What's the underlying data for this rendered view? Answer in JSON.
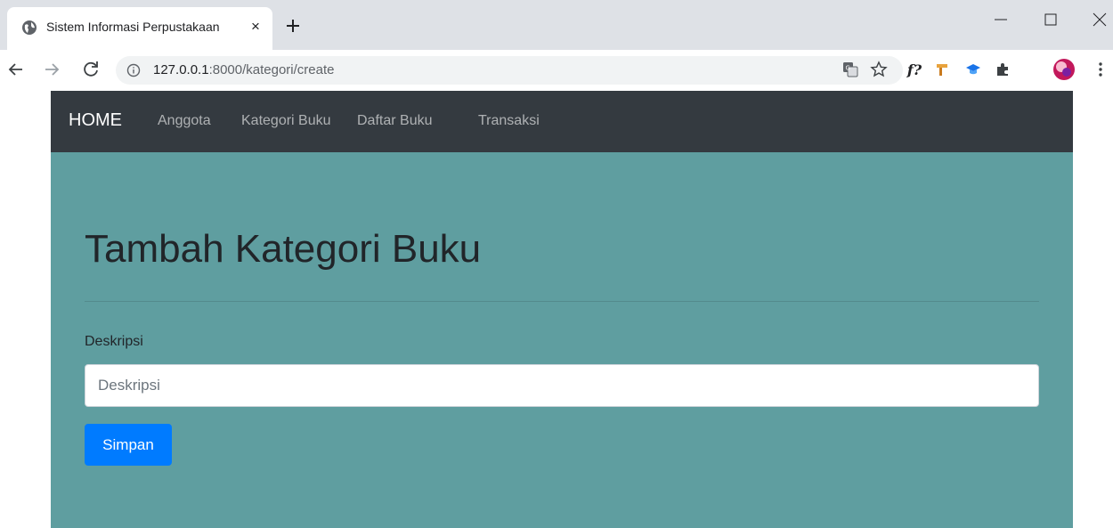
{
  "browser": {
    "tab": {
      "title": "Sistem Informasi Perpustakaan",
      "close_glyph": "×"
    },
    "address_bar": {
      "host": "127.0.0.1",
      "path": ":8000/kategori/create"
    },
    "extensions": {
      "f_label": "f?"
    },
    "icons": [
      "globe-icon",
      "close-icon",
      "plus-icon",
      "minimize-icon",
      "maximize-icon",
      "window-close-icon",
      "back-arrow-icon",
      "forward-arrow-icon",
      "reload-icon",
      "info-icon",
      "translate-icon",
      "star-icon",
      "hammer-icon",
      "graduation-cap-icon",
      "puzzle-icon",
      "profile-avatar-icon",
      "more-menu-icon"
    ]
  },
  "navbar": {
    "brand": "HOME",
    "links": [
      "Anggota",
      "Kategori Buku",
      "Daftar Buku",
      "Transaksi"
    ]
  },
  "form": {
    "heading": "Tambah Kategori Buku",
    "label": "Deskripsi",
    "placeholder": "Deskripsi",
    "value": "",
    "submit_label": "Simpan"
  },
  "colors": {
    "navbar": "#343a40",
    "jumbotron": "#5f9ea0",
    "primary_button": "#007bff"
  }
}
